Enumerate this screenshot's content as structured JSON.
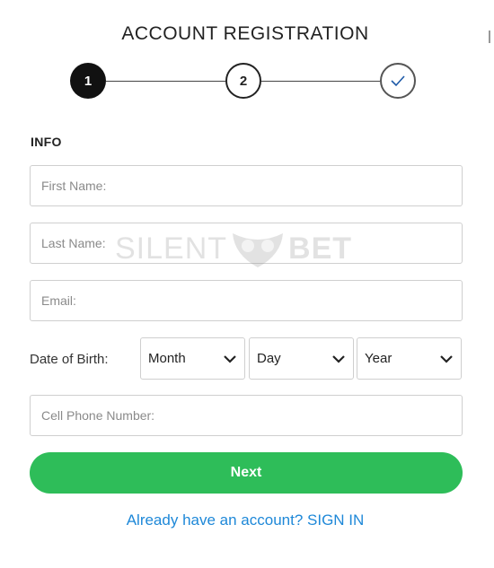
{
  "title": "ACCOUNT REGISTRATION",
  "steps": [
    {
      "label": "1",
      "state": "active"
    },
    {
      "label": "2",
      "state": "pending"
    },
    {
      "label": "",
      "icon": "checkmark-icon",
      "state": "final"
    }
  ],
  "section_label": "INFO",
  "fields": {
    "first_name_placeholder": "First Name:",
    "last_name_placeholder": "Last Name:",
    "email_placeholder": "Email:",
    "phone_placeholder": "Cell Phone Number:"
  },
  "dob": {
    "label": "Date of Birth:",
    "month": "Month",
    "day": "Day",
    "year": "Year"
  },
  "next_label": "Next",
  "signin_label": "Already have an account? SIGN IN",
  "watermark": {
    "left": "SILENT",
    "right": "BET"
  },
  "colors": {
    "primary_button": "#2ebd59",
    "link": "#1e88d8",
    "active_step": "#111111"
  }
}
